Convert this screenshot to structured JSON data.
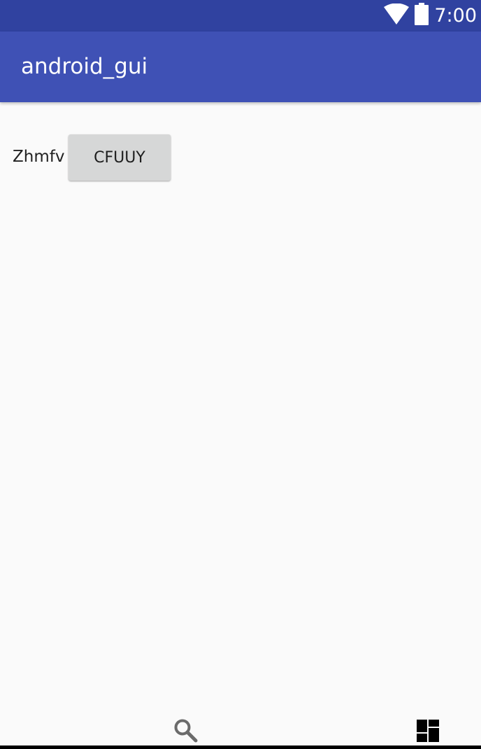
{
  "status_bar": {
    "time": "7:00",
    "icons": [
      "wifi-icon",
      "battery-icon"
    ],
    "background": "#3042a0"
  },
  "app_bar": {
    "title": "android_gui",
    "background": "#3f51b5"
  },
  "content": {
    "label": "Zhmfv",
    "button_label": "CFUUY"
  },
  "bottom_bar": {
    "icons": [
      "search-icon",
      "dashboard-icon"
    ]
  }
}
